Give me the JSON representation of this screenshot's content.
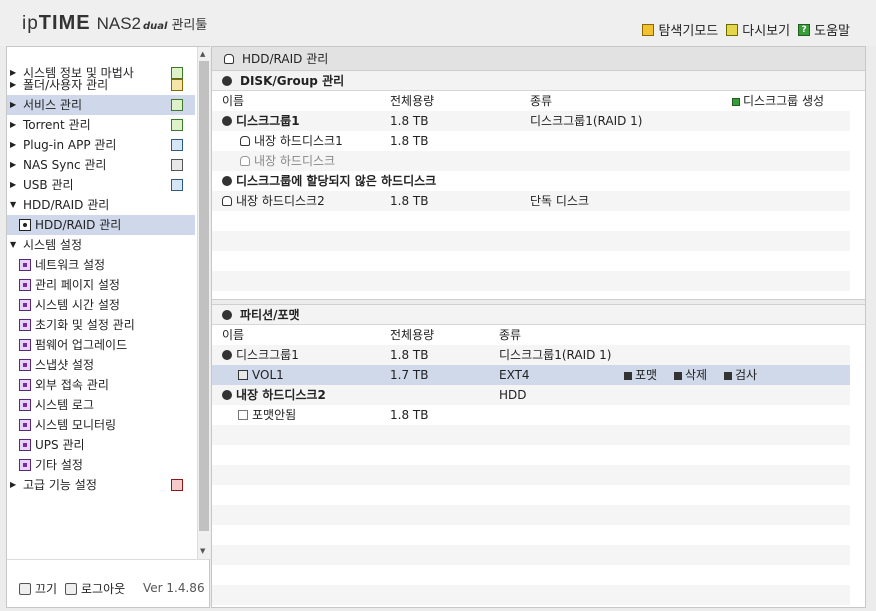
{
  "header": {
    "logo_ip": "ip",
    "logo_time": "TIME",
    "logo_model": "NAS2",
    "logo_dual": "dual",
    "logo_mgr": "관리툴",
    "links": [
      "탐색기모드",
      "다시보기",
      "도움말"
    ]
  },
  "sidebar": {
    "items": [
      {
        "label": "시스템 정보 및 마법사"
      },
      {
        "label": "폴더/사용자 관리"
      },
      {
        "label": "서비스 관리"
      },
      {
        "label": "Torrent 관리"
      },
      {
        "label": "Plug-in APP 관리"
      },
      {
        "label": "NAS Sync 관리"
      },
      {
        "label": "USB 관리"
      },
      {
        "label": "HDD/RAID 관리"
      },
      {
        "label": "HDD/RAID 관리"
      },
      {
        "label": "시스템 설정"
      },
      {
        "label": "네트워크 설정"
      },
      {
        "label": "관리 페이지 설정"
      },
      {
        "label": "시스템 시간 설정"
      },
      {
        "label": "초기화 및 설정 관리"
      },
      {
        "label": "펌웨어 업그레이드"
      },
      {
        "label": "스냅샷 설정"
      },
      {
        "label": "외부 접속 관리"
      },
      {
        "label": "시스템 로그"
      },
      {
        "label": "시스템 모니터링"
      },
      {
        "label": "UPS 관리"
      },
      {
        "label": "기타 설정"
      },
      {
        "label": "고급 기능 설정"
      }
    ],
    "footer": {
      "off": "끄기",
      "logout": "로그아웃",
      "version": "Ver 1.4.86"
    }
  },
  "main": {
    "title": "HDD/RAID 관리",
    "disk_section": {
      "title": "DISK/Group 관리",
      "headers": {
        "name": "이름",
        "capacity": "전체용량",
        "type": "종류",
        "create": "디스크그룹 생성"
      },
      "rows": [
        {
          "name": "디스크그룹1",
          "capacity": "1.8 TB",
          "type": "디스크그룹1(RAID 1)"
        },
        {
          "name": "내장 하드디스크1",
          "capacity": "1.8 TB",
          "type": ""
        },
        {
          "name": "내장 하드디스크",
          "capacity": "",
          "type": ""
        },
        {
          "name": "디스크그룹에 할당되지 않은 하드디스크",
          "capacity": "",
          "type": ""
        },
        {
          "name": "내장 하드디스크2",
          "capacity": "1.8 TB",
          "type": "단독 디스크"
        }
      ]
    },
    "part_section": {
      "title": "파티션/포맷",
      "headers": {
        "name": "이름",
        "capacity": "전체용량",
        "type": "종류"
      },
      "rows": [
        {
          "name": "디스크그룹1",
          "capacity": "1.8 TB",
          "type": "디스크그룹1(RAID 1)"
        },
        {
          "name": "VOL1",
          "capacity": "1.7 TB",
          "type": "EXT4"
        },
        {
          "name": "내장 하드디스크2",
          "capacity": "",
          "type": "HDD"
        },
        {
          "name": "포맷안됨",
          "capacity": "1.8 TB",
          "type": ""
        }
      ],
      "actions": [
        "포맷",
        "삭제",
        "검사"
      ]
    }
  }
}
